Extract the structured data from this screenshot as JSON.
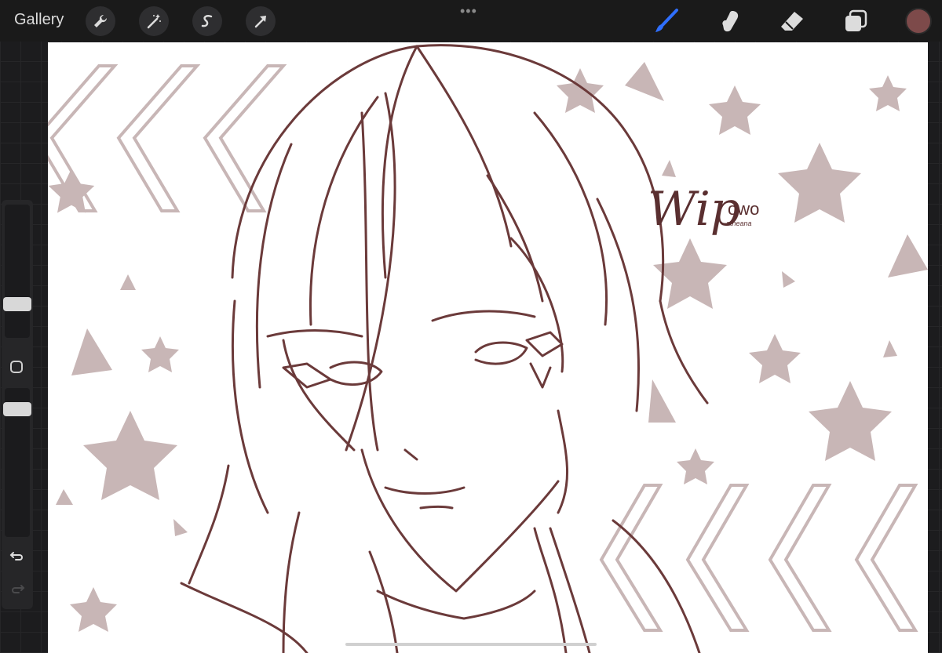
{
  "toolbar": {
    "gallery_label": "Gallery",
    "left_tools": [
      "wrench-icon",
      "magic-wand-icon",
      "selection-s-icon",
      "transform-arrow-icon"
    ],
    "more_menu": "•••",
    "right_tools": [
      "brush-icon",
      "smudge-icon",
      "eraser-icon",
      "layers-icon"
    ],
    "active_tool": "brush-icon",
    "accent_color": "#2f6fff",
    "current_color": "#7d4a4a"
  },
  "sidebar": {
    "brush_size_level": 0.35,
    "opacity_level": 0.9,
    "undo_icon": "undo-arrow-icon",
    "redo_icon": "redo-arrow-icon"
  },
  "artwork": {
    "line_color": "#6b3a3a",
    "shape_color": "#c8b6b6",
    "title_text": "Wip",
    "subtitle_text": "owo",
    "signature_text": "atheana"
  }
}
